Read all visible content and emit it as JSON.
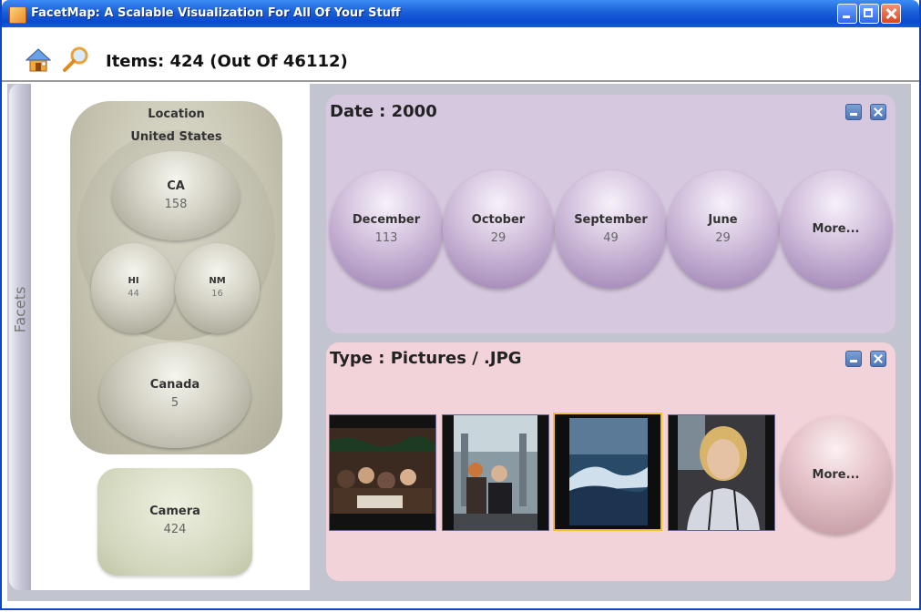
{
  "window": {
    "title": "FacetMap: A Scalable Visualization For All Of Your Stuff"
  },
  "toolbar": {
    "items_label": "Items: 424 (Out Of 46112)"
  },
  "sidebar": {
    "label": "Facets",
    "location": {
      "title": "Location",
      "country": "United States",
      "states": [
        {
          "name": "CA",
          "count": "158"
        },
        {
          "name": "HI",
          "count": "44"
        },
        {
          "name": "NM",
          "count": "16"
        }
      ],
      "other": {
        "name": "Canada",
        "count": "5"
      }
    },
    "camera": {
      "name": "Camera",
      "count": "424"
    }
  },
  "date_panel": {
    "title": "Date : 2000",
    "bubbles": [
      {
        "label": "December",
        "count": "113"
      },
      {
        "label": "October",
        "count": "29"
      },
      {
        "label": "September",
        "count": "49"
      },
      {
        "label": "June",
        "count": "29"
      }
    ],
    "more_label": "More..."
  },
  "type_panel": {
    "title": "Type : Pictures / .JPG",
    "thumbnails": [
      {
        "subject": "dinner-party-photo"
      },
      {
        "subject": "mall-atrium-photo"
      },
      {
        "subject": "ocean-wave-photo",
        "selected": true
      },
      {
        "subject": "woman-portrait-photo"
      }
    ],
    "more_label": "More..."
  },
  "colors": {
    "titlebar": "#0b4ad0",
    "date_panel": "#d6c8df",
    "type_panel": "#f3d3da",
    "location_box": "#c6c3b0",
    "camera_box": "#d2d6bc",
    "selection": "#f2c12e"
  }
}
